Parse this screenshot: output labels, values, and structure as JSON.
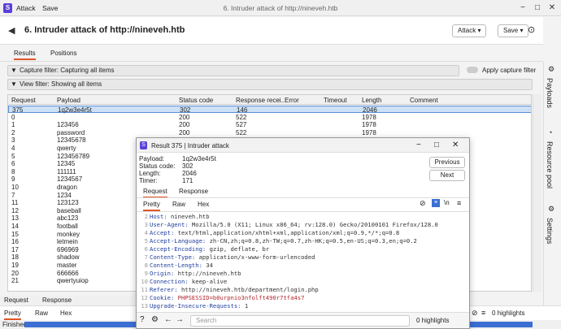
{
  "menu": {
    "logo": "S",
    "items": [
      "Attack",
      "Save"
    ],
    "window_title": "6. Intruder attack of http://nineveh.htb"
  },
  "header": {
    "title": "6. Intruder attack of http://nineveh.htb",
    "attack_btn": "Attack ▾",
    "save_btn": "Save ▾"
  },
  "tabs": [
    "Results",
    "Positions"
  ],
  "filters": {
    "capture": "Capture filter: Capturing all items",
    "view": "View filter: Showing all items",
    "apply_capture": "Apply capture filter"
  },
  "table": {
    "columns": [
      "Request",
      "Payload",
      "Status code",
      "Response recei...",
      "Error",
      "Timeout",
      "Length",
      "Comment"
    ],
    "rows": [
      [
        "375",
        "1q2w3e4r5t",
        "302",
        "146",
        "",
        "",
        "2046",
        ""
      ],
      [
        "0",
        "",
        "200",
        "522",
        "",
        "",
        "1978",
        ""
      ],
      [
        "1",
        "123456",
        "200",
        "527",
        "",
        "",
        "1978",
        ""
      ],
      [
        "2",
        "password",
        "200",
        "522",
        "",
        "",
        "1978",
        ""
      ],
      [
        "3",
        "12345678",
        "",
        "",
        "",
        "",
        "",
        ""
      ],
      [
        "4",
        "qwerty",
        "",
        "",
        "",
        "",
        "",
        ""
      ],
      [
        "5",
        "123456789",
        "",
        "",
        "",
        "",
        "",
        ""
      ],
      [
        "6",
        "12345",
        "",
        "",
        "",
        "",
        "",
        ""
      ],
      [
        "8",
        "111111",
        "",
        "",
        "",
        "",
        "",
        ""
      ],
      [
        "9",
        "1234567",
        "",
        "",
        "",
        "",
        "",
        ""
      ],
      [
        "10",
        "dragon",
        "",
        "",
        "",
        "",
        "",
        ""
      ],
      [
        "7",
        "1234",
        "",
        "",
        "",
        "",
        "",
        ""
      ],
      [
        "11",
        "123123",
        "",
        "",
        "",
        "",
        "",
        ""
      ],
      [
        "12",
        "baseball",
        "",
        "",
        "",
        "",
        "",
        ""
      ],
      [
        "13",
        "abc123",
        "",
        "",
        "",
        "",
        "",
        ""
      ],
      [
        "14",
        "football",
        "",
        "",
        "",
        "",
        "",
        ""
      ],
      [
        "15",
        "monkey",
        "",
        "",
        "",
        "",
        "",
        ""
      ],
      [
        "16",
        "letmein",
        "",
        "",
        "",
        "",
        "",
        ""
      ],
      [
        "17",
        "696969",
        "",
        "",
        "",
        "",
        "",
        ""
      ],
      [
        "18",
        "shadow",
        "",
        "",
        "",
        "",
        "",
        ""
      ],
      [
        "19",
        "master",
        "",
        "",
        "",
        "",
        "",
        ""
      ],
      [
        "20",
        "666666",
        "",
        "",
        "",
        "",
        "",
        ""
      ],
      [
        "21",
        "qwertyuiop",
        "",
        "",
        "",
        "",
        "",
        ""
      ]
    ]
  },
  "sidebar": [
    "Payloads",
    "Resource pool",
    "Settings"
  ],
  "bottom": {
    "tabs": [
      "Request",
      "Response"
    ],
    "subtabs": [
      "Pretty",
      "Raw",
      "Hex"
    ],
    "highlights": "0 highlights"
  },
  "status": {
    "label": "Finished",
    "progress": 1.0
  },
  "popup": {
    "title": "Result 375 | Intruder attack",
    "meta": [
      [
        "Payload:",
        "1q2w3e4r5t"
      ],
      [
        "Status code:",
        "302"
      ],
      [
        "Length:",
        "2046"
      ],
      [
        "Timer:",
        "171"
      ]
    ],
    "previous": "Previous",
    "next": "Next",
    "tabs": [
      "Request",
      "Response"
    ],
    "subtabs": [
      "Pretty",
      "Raw",
      "Hex"
    ],
    "lines": [
      {
        "n": "2",
        "k": "Host:",
        "v": " nineveh.htb"
      },
      {
        "n": "3",
        "k": "User-Agent:",
        "v": " Mozilla/5.0 (X11; Linux x86_64; rv:128.0) Gecko/20100101 Firefox/128.0"
      },
      {
        "n": "4",
        "k": "Accept:",
        "v": " text/html,application/xhtml+xml,application/xml;q=0.9,*/*;q=0.8"
      },
      {
        "n": "5",
        "k": "Accept-Language:",
        "v": " zh-CN,zh;q=0.8,zh-TW;q=0.7,zh-HK;q=0.5,en-US;q=0.3,en;q=0.2"
      },
      {
        "n": "6",
        "k": "Accept-Encoding:",
        "v": " gzip, deflate, br"
      },
      {
        "n": "7",
        "k": "Content-Type:",
        "v": " application/x-www-form-urlencoded"
      },
      {
        "n": "8",
        "k": "Content-Length:",
        "v": " 34"
      },
      {
        "n": "9",
        "k": "Origin:",
        "v": " http://nineveh.htb"
      },
      {
        "n": "10",
        "k": "Connection:",
        "v": " keep-alive"
      },
      {
        "n": "11",
        "k": "Referer:",
        "v": " http://nineveh.htb/department/login.php"
      },
      {
        "n": "12",
        "k": "Cookie:",
        "v": " PHPSESSID=b0urpnio3nfolft490r7tfa4s7"
      },
      {
        "n": "13",
        "k": "Upgrade-Insecure-Requests:",
        "v": " 1"
      }
    ],
    "search_placeholder": "Search",
    "highlights": "0 highlights"
  },
  "colors": {
    "accent": "#e0562a",
    "selection": "#cde0f5",
    "progress": "#3b6fd4"
  }
}
